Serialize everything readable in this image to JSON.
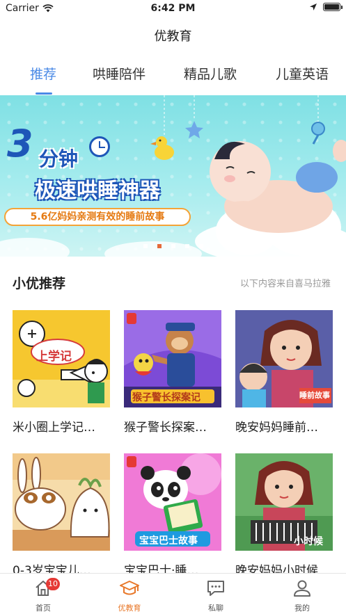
{
  "status_bar": {
    "carrier": "Carrier",
    "time": "6:42 PM"
  },
  "nav": {
    "title": "优教育"
  },
  "tabs": [
    {
      "label": "推荐",
      "active": true
    },
    {
      "label": "哄睡陪伴",
      "active": false
    },
    {
      "label": "精品儿歌",
      "active": false
    },
    {
      "label": "儿童英语",
      "active": false
    }
  ],
  "banner": {
    "number": "3",
    "headline1": "分钟",
    "headline2": "极速哄睡神器",
    "subline": "5.6亿妈妈亲测有效的睡前故事",
    "page_count": 5,
    "active_page": 2
  },
  "section": {
    "title": "小优推荐",
    "source": "以下内容来自喜马拉雅"
  },
  "items": [
    {
      "title": "米小圈上学记…",
      "thumb_text": "上学记"
    },
    {
      "title": "猴子警长探案…",
      "thumb_text": "猴子警长探案记"
    },
    {
      "title": "晚安妈妈睡前…",
      "thumb_text": "睡前故事"
    },
    {
      "title": "0-3岁宝宝儿…",
      "thumb_text": ""
    },
    {
      "title": "宝宝巴士·睡…",
      "thumb_text": "宝宝巴士故事"
    },
    {
      "title": "晚安妈妈小时候",
      "thumb_text": "小时候"
    }
  ],
  "tabbar": {
    "items": [
      {
        "label": "首页",
        "icon": "home-icon",
        "badge": "10"
      },
      {
        "label": "优教育",
        "icon": "education-icon",
        "active": true
      },
      {
        "label": "私聊",
        "icon": "chat-icon"
      },
      {
        "label": "我的",
        "icon": "profile-icon"
      }
    ]
  },
  "colors": {
    "accent_blue": "#4a8ae6",
    "accent_orange": "#e8782a",
    "badge_red": "#e53935"
  }
}
